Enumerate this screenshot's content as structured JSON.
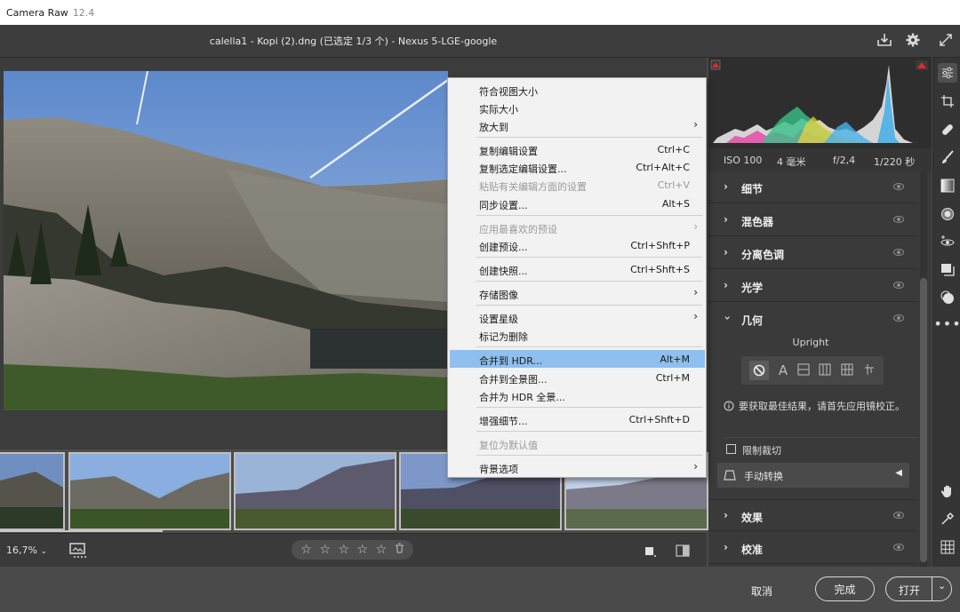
{
  "os_title": {
    "app": "Camera Raw",
    "version": "12.4"
  },
  "header": {
    "doc_title": "calella1 - Kopi (2).dng (已选定 1/3 个) - Nexus 5-LGE-google"
  },
  "exif": {
    "iso": "ISO 100",
    "focal": "4 毫米",
    "aperture": "f/2,4",
    "shutter": "1/220 秒"
  },
  "panel": {
    "sections": [
      {
        "label": "细节"
      },
      {
        "label": "混色器"
      },
      {
        "label": "分离色调"
      },
      {
        "label": "光学"
      },
      {
        "label": "几何"
      },
      {
        "label": "效果"
      },
      {
        "label": "校准"
      }
    ],
    "geometry": {
      "upright_label": "Upright",
      "info_text": "要获取最佳结果，请首先应用镜校正。",
      "constrain_crop_label": "限制裁切",
      "manual_transform_label": "手动转换"
    }
  },
  "bottom_bar": {
    "zoom": "16,7%"
  },
  "footer": {
    "cancel": "取消",
    "done": "完成",
    "open": "打开"
  },
  "menu": {
    "items": [
      {
        "label": "符合视图大小",
        "shortcut": ""
      },
      {
        "label": "实际大小",
        "shortcut": ""
      },
      {
        "label": "放大到",
        "shortcut": ""
      },
      {
        "label": "复制编辑设置",
        "shortcut": "Ctrl+C"
      },
      {
        "label": "复制选定编辑设置...",
        "shortcut": "Ctrl+Alt+C"
      },
      {
        "label": "粘贴有关编辑方面的设置",
        "shortcut": "Ctrl+V"
      },
      {
        "label": "同步设置...",
        "shortcut": "Alt+S"
      },
      {
        "label": "应用最喜欢的预设",
        "shortcut": ""
      },
      {
        "label": "创建预设...",
        "shortcut": "Ctrl+Shft+P"
      },
      {
        "label": "创建快照...",
        "shortcut": "Ctrl+Shft+S"
      },
      {
        "label": "存储图像",
        "shortcut": ""
      },
      {
        "label": "设置星级",
        "shortcut": ""
      },
      {
        "label": "标记为删除",
        "shortcut": ""
      },
      {
        "label": "合并到 HDR...",
        "shortcut": "Alt+M"
      },
      {
        "label": "合并到全景图...",
        "shortcut": "Ctrl+M"
      },
      {
        "label": "合并为 HDR 全景...",
        "shortcut": ""
      },
      {
        "label": "增强细节...",
        "shortcut": "Ctrl+Shft+D"
      },
      {
        "label": "复位为默认值",
        "shortcut": ""
      },
      {
        "label": "背景选项",
        "shortcut": ""
      }
    ]
  },
  "colors": {
    "menu_highlight": "#8ebfef",
    "panel_bg": "#3a3a3a",
    "clip_warning": "#e8262a"
  },
  "icons": [
    "download-icon",
    "gear-icon",
    "fullscreen-icon",
    "edit-sliders-icon",
    "crop-icon",
    "healing-icon",
    "brush-icon",
    "gradient-icon",
    "radial-icon",
    "redeye-icon",
    "snapshots-icon",
    "presets-icon",
    "more-icon",
    "hand-icon",
    "eyedropper-icon",
    "grid-icon",
    "star-icon",
    "trash-icon",
    "info-icon",
    "chevron-right-icon"
  ]
}
